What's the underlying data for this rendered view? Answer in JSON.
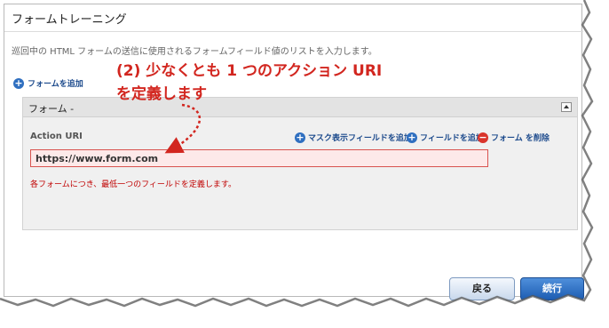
{
  "dialog": {
    "title": "フォームトレーニング",
    "description": "巡回中の HTML フォームの送信に使用されるフォームフィールド値のリストを入力します。",
    "add_form_label": "フォームを追加"
  },
  "panel": {
    "title": "フォーム -",
    "field_label": "Action URI",
    "actions": {
      "add_mask_field": "マスク表示フィールドを追加",
      "add_field": "フィールドを追加",
      "remove_form": "フォーム を削除"
    },
    "url_value": "https://www.form.com",
    "error_message": "各フォームにつき、最低一つのフィールドを定義します。"
  },
  "annotation": {
    "line1": "(2) 少なくとも 1 つのアクション URI",
    "line2": "を定義します"
  },
  "footer": {
    "back_label": "戻る",
    "next_label": "続行"
  },
  "colors": {
    "accent_blue": "#2f6fc0",
    "error_red": "#c00000",
    "annotation_red": "#d2261f",
    "input_error_bg": "#fde9e9"
  }
}
